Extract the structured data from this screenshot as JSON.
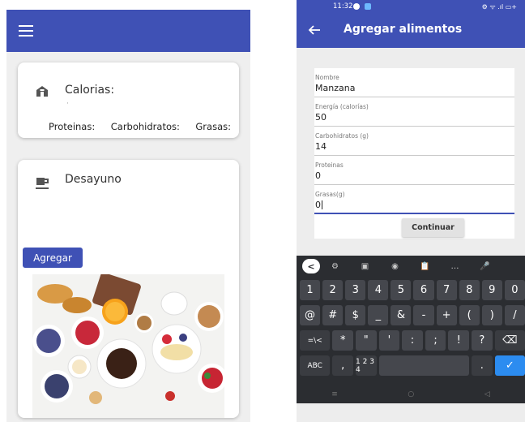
{
  "left_screen": {
    "menu_icon": "hamburger-menu-icon",
    "calories_card": {
      "icon": "home-icon",
      "title": "Calorias:",
      "value_placeholder": "·",
      "macros": [
        "Proteinas:",
        "Carbohidratos:",
        "Grasas:"
      ]
    },
    "breakfast_card": {
      "icon": "coffee-cup-icon",
      "title": "Desayuno",
      "add_button": "Agregar"
    },
    "colors": {
      "appbar": "#3f51b5",
      "button": "#3f51b5",
      "background": "#efefef"
    }
  },
  "right_screen": {
    "status_bar": {
      "time": "11:32",
      "indicators": "⚙ ᯤ .ıl ▭+"
    },
    "appbar_title": "Agregar alimentos",
    "back_icon": "arrow-left-icon",
    "form": {
      "fields": [
        {
          "label": "Nombre",
          "value": "Manzana"
        },
        {
          "label": "Energía (calorías)",
          "value": "50"
        },
        {
          "label": "Carbohidratos (g)",
          "value": "14"
        },
        {
          "label": "Proteinas",
          "value": "0"
        },
        {
          "label": "Grasas(g)",
          "value": "0"
        }
      ],
      "submit_button": "Continuar"
    },
    "keyboard": {
      "toolbar": [
        "<",
        "⚙",
        "▣",
        "◉",
        "📋",
        "…",
        "🎤"
      ],
      "rows": [
        [
          "1",
          "2",
          "3",
          "4",
          "5",
          "6",
          "7",
          "8",
          "9",
          "0"
        ],
        [
          "@",
          "#",
          "$",
          "_",
          "&",
          "-",
          "+",
          "(",
          ")",
          "/"
        ],
        [
          "=\\<",
          "*",
          "\"",
          "'",
          ":",
          ";",
          "!",
          "?",
          "⌫"
        ],
        [
          "ABC",
          ",",
          "1 2 3 4",
          "",
          ".",
          "✓"
        ]
      ],
      "nav": [
        "≡",
        "○",
        "◁"
      ]
    }
  }
}
